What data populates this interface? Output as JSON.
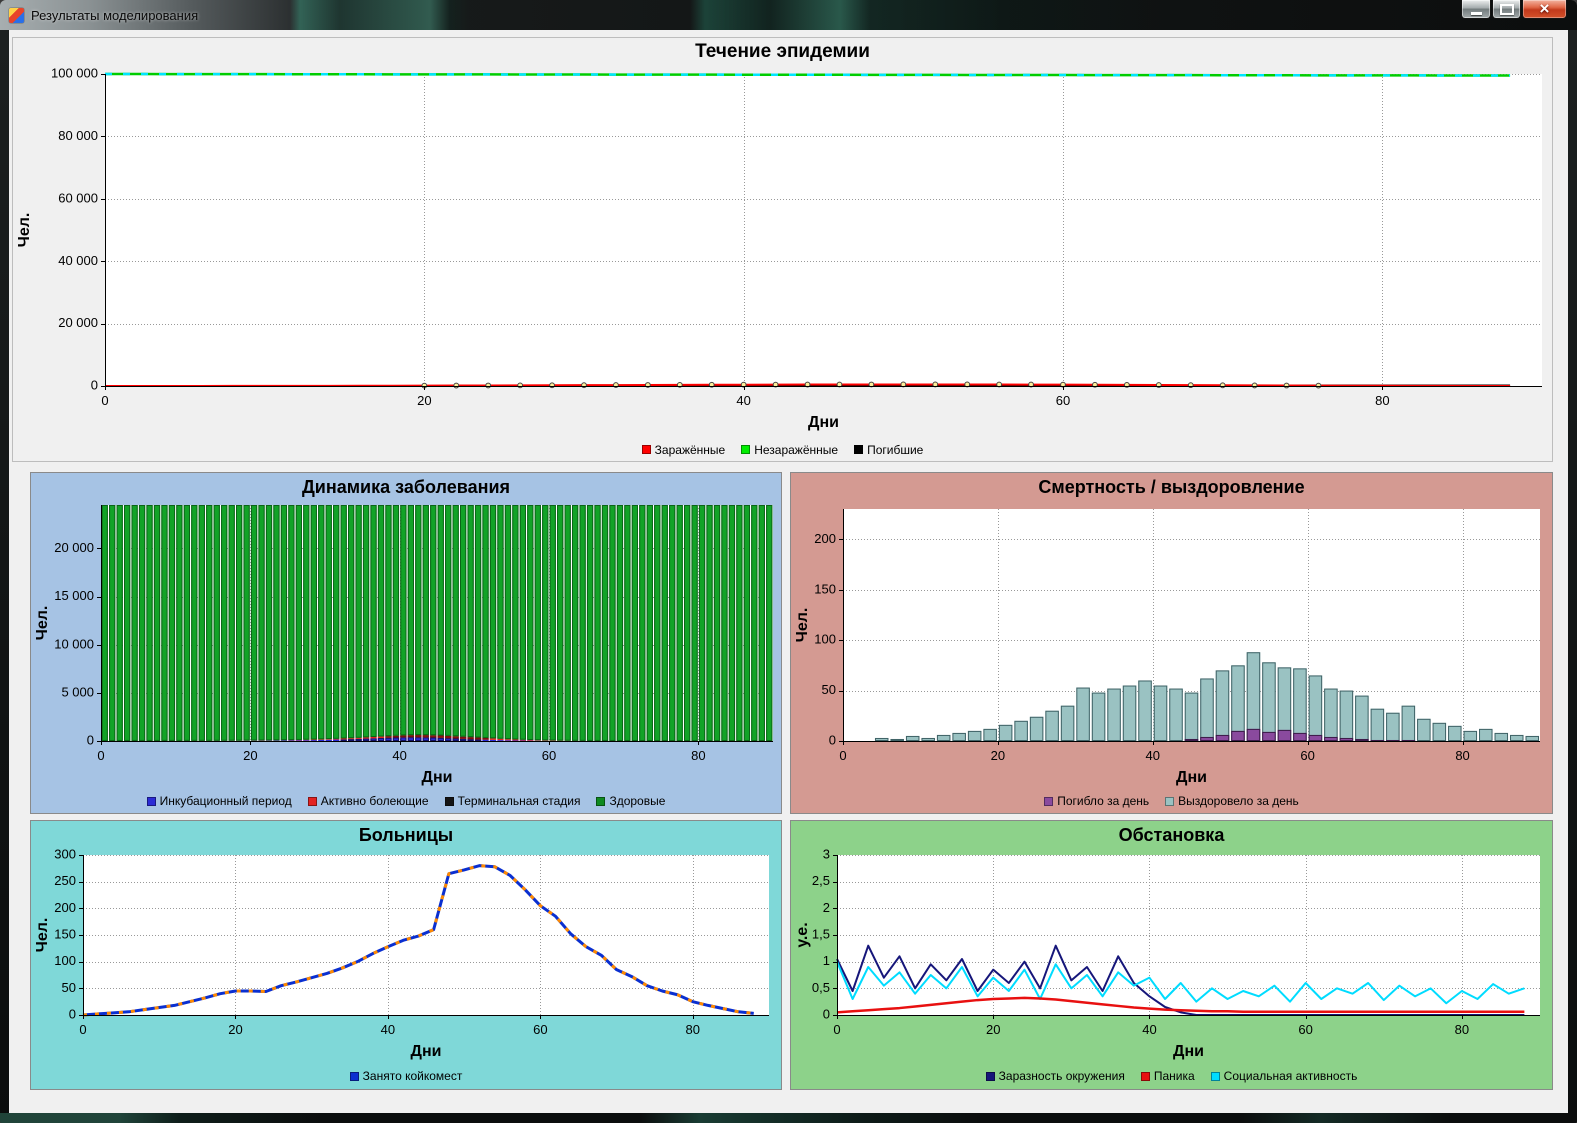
{
  "window": {
    "title": "Результаты моделирования",
    "controls": {
      "close": "×"
    }
  },
  "chart_data": [
    {
      "id": "epidemic",
      "type": "line",
      "title": "Течение эпидемии",
      "xlabel": "Дни",
      "ylabel": "Чел.",
      "bg": "#f0f0f0",
      "xlim": [
        0,
        90
      ],
      "ylim": [
        0,
        100000
      ],
      "xticks": [
        0,
        20,
        40,
        60,
        80
      ],
      "xtick_labels": [
        "0",
        "20",
        "40",
        "60",
        "80"
      ],
      "yticks": [
        0,
        20000,
        40000,
        60000,
        80000,
        100000
      ],
      "ytick_labels": [
        "0",
        "20 000",
        "40 000",
        "60 000",
        "80 000",
        "100 000"
      ],
      "x_start": 0,
      "x_step": 2,
      "series": [
        {
          "name": "Незаражённые",
          "color": "#00cc00",
          "width": 2.5,
          "overlay": {
            "color": "#00e5ff",
            "dash": [
              7,
              11
            ],
            "width": 2.5
          },
          "values": [
            99995,
            99984,
            99973,
            99962,
            99951,
            99940,
            99929,
            99918,
            99907,
            99896,
            99885,
            99874,
            99863,
            99852,
            99841,
            99830,
            99819,
            99808,
            99797,
            99786,
            99775,
            99764,
            99753,
            99742,
            99731,
            99720,
            99709,
            99698,
            99687,
            99676,
            99665,
            99654,
            99643,
            99632,
            99621,
            99610,
            99599,
            99588,
            99577,
            99566,
            99555,
            99544,
            99533,
            99522,
            99511
          ]
        },
        {
          "name": "Погибшие",
          "color": "#000000",
          "width": 1.5,
          "values": [
            0,
            0,
            1,
            2,
            4,
            6,
            9,
            13,
            18,
            24,
            31,
            39,
            48,
            58,
            69,
            81,
            94,
            108,
            122,
            136,
            150,
            163,
            175,
            186,
            196,
            205,
            213,
            220,
            226,
            231,
            235,
            238,
            241,
            243,
            245,
            246,
            247,
            248,
            249,
            250,
            250,
            250,
            250,
            250,
            250
          ]
        },
        {
          "name": "Заражённые",
          "color": "#ff0000",
          "width": 2,
          "marker": {
            "type": "circle",
            "fill": "#ffef9a",
            "stroke": "#444444",
            "r": 2.4,
            "min": 100
          },
          "values": [
            5,
            8,
            12,
            18,
            25,
            34,
            45,
            60,
            78,
            98,
            120,
            145,
            172,
            200,
            230,
            262,
            295,
            328,
            360,
            390,
            418,
            442,
            462,
            478,
            490,
            497,
            500,
            495,
            482,
            460,
            430,
            394,
            354,
            312,
            270,
            228,
            188,
            152,
            120,
            92,
            68,
            48,
            32,
            20,
            12
          ]
        }
      ],
      "legend": [
        {
          "label": "Заражённые",
          "color": "#ff0000"
        },
        {
          "label": "Незаражённые",
          "color": "#00ee00"
        },
        {
          "label": "Погибшие",
          "color": "#000000"
        }
      ]
    },
    {
      "id": "dynamics",
      "type": "stacked-bar",
      "title": "Динамика заболевания",
      "xlabel": "Дни",
      "ylabel": "Чел.",
      "bg": "#a6c3e4",
      "xlim": [
        0,
        90
      ],
      "ylim": [
        0,
        24500
      ],
      "xticks": [
        0,
        20,
        40,
        60,
        80
      ],
      "xtick_labels": [
        "0",
        "20",
        "40",
        "60",
        "80"
      ],
      "yticks": [
        0,
        5000,
        10000,
        15000,
        20000
      ],
      "ytick_labels": [
        "0",
        "5 000",
        "10 000",
        "15 000",
        "20 000"
      ],
      "bar_start": 0,
      "bar_step": 1,
      "series": [
        {
          "name": "Инкубационный период",
          "color": "#2b2bd5",
          "edge": "#111166",
          "values": [
            2,
            2,
            3,
            3,
            4,
            4,
            5,
            5,
            6,
            6,
            8,
            8,
            10,
            10,
            12,
            14,
            16,
            18,
            20,
            24,
            28,
            32,
            38,
            44,
            52,
            60,
            70,
            82,
            95,
            110,
            128,
            148,
            170,
            195,
            220,
            248,
            278,
            308,
            338,
            365,
            388,
            400,
            398,
            385,
            362,
            332,
            298,
            262,
            228,
            195,
            165,
            138,
            114,
            92,
            74,
            58,
            45,
            34,
            26,
            19,
            14,
            10,
            7,
            5,
            4,
            3,
            2,
            2,
            1,
            1,
            1,
            0,
            0,
            0,
            0,
            0,
            0,
            0,
            0,
            0,
            0,
            0,
            0,
            0,
            0,
            0,
            0,
            0,
            0,
            0
          ]
        },
        {
          "name": "Активно болеющие",
          "color": "#e32222",
          "edge": "#7a0f0f",
          "values": [
            1,
            1,
            1,
            2,
            2,
            2,
            3,
            3,
            4,
            4,
            5,
            5,
            6,
            7,
            8,
            9,
            10,
            12,
            14,
            16,
            18,
            21,
            24,
            28,
            32,
            37,
            42,
            48,
            55,
            62,
            70,
            79,
            89,
            100,
            112,
            125,
            138,
            152,
            166,
            180,
            193,
            205,
            215,
            223,
            228,
            230,
            228,
            222,
            213,
            200,
            185,
            168,
            150,
            132,
            114,
            97,
            81,
            66,
            53,
            42,
            33,
            25,
            19,
            14,
            10,
            7,
            5,
            4,
            3,
            2,
            1,
            1,
            1,
            1,
            0,
            0,
            0,
            0,
            0,
            0,
            0,
            0,
            0,
            0,
            0,
            0,
            0,
            0,
            0,
            0
          ]
        },
        {
          "name": "Терминальная стадия",
          "color": "#141414",
          "edge": "#000000",
          "values": [
            0,
            0,
            0,
            0,
            0,
            0,
            0,
            0,
            0,
            0,
            0,
            0,
            0,
            0,
            0,
            0,
            0,
            0,
            0,
            0,
            0,
            0,
            0,
            0,
            0,
            0,
            0,
            0,
            0,
            0,
            0,
            0,
            0,
            0,
            1,
            1,
            1,
            2,
            2,
            3,
            4,
            5,
            6,
            7,
            8,
            9,
            10,
            11,
            12,
            12,
            12,
            11,
            10,
            9,
            8,
            7,
            6,
            5,
            4,
            3,
            2,
            2,
            1,
            1,
            1,
            0,
            0,
            0,
            0,
            0,
            0,
            0,
            0,
            0,
            0,
            0,
            0,
            0,
            0,
            0,
            0,
            0,
            0,
            0,
            0,
            0,
            0,
            0,
            0,
            0
          ]
        },
        {
          "name": "Здоровые",
          "color": "#12a327",
          "edge": "#0b6417",
          "rest": true
        }
      ],
      "legend": [
        {
          "label": "Инкубационный период",
          "color": "#2b2bd5"
        },
        {
          "label": "Активно болеющие",
          "color": "#e32222"
        },
        {
          "label": "Терминальная стадия",
          "color": "#141414"
        },
        {
          "label": "Здоровые",
          "color": "#0e8a20"
        }
      ]
    },
    {
      "id": "mortality",
      "type": "bar",
      "title": "Смертность / выздоровление",
      "xlabel": "Дни",
      "ylabel": "Чел.",
      "bg": "#d49a92",
      "xlim": [
        0,
        90
      ],
      "ylim": [
        0,
        230
      ],
      "xticks": [
        0,
        20,
        40,
        60,
        80
      ],
      "xtick_labels": [
        "0",
        "20",
        "40",
        "60",
        "80"
      ],
      "yticks": [
        0,
        50,
        100,
        150,
        200
      ],
      "ytick_labels": [
        "0",
        "50",
        "100",
        "150",
        "200"
      ],
      "bar_start": 0,
      "bar_step": 2,
      "series": [
        {
          "name": "Выздоровело за день",
          "color": "#9ac2c2",
          "edge": "#3f6266",
          "values": [
            0,
            0,
            3,
            2,
            5,
            3,
            6,
            8,
            10,
            12,
            16,
            20,
            24,
            30,
            35,
            53,
            48,
            52,
            55,
            60,
            55,
            52,
            48,
            62,
            70,
            75,
            88,
            78,
            73,
            72,
            65,
            52,
            50,
            45,
            32,
            28,
            35,
            22,
            18,
            15,
            10,
            12,
            8,
            6,
            5
          ]
        },
        {
          "name": "Погибло за день",
          "color": "#8a4a9e",
          "edge": "#3c1c49",
          "values": [
            0,
            0,
            0,
            0,
            0,
            0,
            0,
            0,
            0,
            0,
            0,
            0,
            0,
            0,
            0,
            0,
            0,
            0,
            0,
            0,
            0,
            0,
            2,
            4,
            6,
            10,
            12,
            9,
            11,
            8,
            6,
            4,
            3,
            2,
            1,
            1,
            1,
            0,
            0,
            0,
            0,
            0,
            0,
            0,
            0
          ]
        }
      ],
      "legend": [
        {
          "label": "Погибло за день",
          "color": "#8a4a9e"
        },
        {
          "label": "Выздоровело за день",
          "color": "#9ac2c2"
        }
      ]
    },
    {
      "id": "hospitals",
      "type": "line",
      "title": "Больницы",
      "xlabel": "Дни",
      "ylabel": "Чел.",
      "bg": "#7fd8d8",
      "xlim": [
        0,
        90
      ],
      "ylim": [
        0,
        300
      ],
      "xticks": [
        0,
        20,
        40,
        60,
        80
      ],
      "xtick_labels": [
        "0",
        "20",
        "40",
        "60",
        "80"
      ],
      "yticks": [
        0,
        50,
        100,
        150,
        200,
        250,
        300
      ],
      "ytick_labels": [
        "0",
        "50",
        "100",
        "150",
        "200",
        "250",
        "300"
      ],
      "x_start": 0,
      "x_step": 2,
      "series": [
        {
          "name": "Занято койкомест",
          "color": "#0a2fd0",
          "width": 3,
          "overlay": {
            "color": "#ff8a00",
            "dash": [
              4,
              8
            ],
            "width": 3
          },
          "values": [
            0,
            2,
            4,
            6,
            10,
            14,
            18,
            25,
            32,
            40,
            45,
            45,
            44,
            55,
            62,
            70,
            78,
            88,
            100,
            115,
            128,
            140,
            148,
            160,
            265,
            272,
            280,
            278,
            262,
            235,
            205,
            185,
            152,
            128,
            112,
            85,
            72,
            55,
            45,
            38,
            25,
            18,
            12,
            6,
            3
          ]
        }
      ],
      "legend": [
        {
          "label": "Занято койкомест",
          "color": "#0a2fd0"
        }
      ]
    },
    {
      "id": "situation",
      "type": "line",
      "title": "Обстановка",
      "xlabel": "Дни",
      "ylabel": "у.е.",
      "bg": "#8dd28a",
      "xlim": [
        0,
        90
      ],
      "ylim": [
        0,
        3
      ],
      "xticks": [
        0,
        20,
        40,
        60,
        80
      ],
      "xtick_labels": [
        "0",
        "20",
        "40",
        "60",
        "80"
      ],
      "yticks": [
        0,
        0.5,
        1,
        1.5,
        2,
        2.5,
        3
      ],
      "ytick_labels": [
        "0",
        "0,5",
        "1",
        "1,5",
        "2",
        "2,5",
        "3"
      ],
      "x_start": 0,
      "x_step": 2,
      "series": [
        {
          "name": "Заразность окружения",
          "color": "#16167a",
          "width": 2,
          "values": [
            1.05,
            0.45,
            1.3,
            0.7,
            1.1,
            0.5,
            0.95,
            0.65,
            1.05,
            0.45,
            0.85,
            0.6,
            1.0,
            0.5,
            1.3,
            0.65,
            0.9,
            0.45,
            1.1,
            0.6,
            0.35,
            0.15,
            0.05,
            0,
            0,
            0,
            0,
            0,
            0,
            0,
            0,
            0,
            0,
            0,
            0,
            0,
            0,
            0,
            0,
            0,
            0,
            0,
            0,
            0,
            0
          ]
        },
        {
          "name": "Социальная активность",
          "color": "#00dcff",
          "width": 2,
          "values": [
            1.0,
            0.3,
            0.9,
            0.55,
            0.8,
            0.4,
            0.75,
            0.5,
            0.9,
            0.35,
            0.7,
            0.45,
            0.85,
            0.3,
            0.95,
            0.5,
            0.75,
            0.35,
            0.8,
            0.55,
            0.7,
            0.3,
            0.6,
            0.25,
            0.5,
            0.3,
            0.45,
            0.35,
            0.55,
            0.25,
            0.6,
            0.3,
            0.5,
            0.4,
            0.6,
            0.28,
            0.55,
            0.35,
            0.5,
            0.22,
            0.45,
            0.3,
            0.58,
            0.4,
            0.5
          ]
        },
        {
          "name": "Паника",
          "color": "#e81010",
          "width": 2.5,
          "values": [
            0.05,
            0.07,
            0.09,
            0.11,
            0.13,
            0.16,
            0.19,
            0.22,
            0.25,
            0.28,
            0.3,
            0.31,
            0.32,
            0.31,
            0.29,
            0.26,
            0.23,
            0.2,
            0.17,
            0.14,
            0.12,
            0.1,
            0.09,
            0.08,
            0.07,
            0.07,
            0.06,
            0.06,
            0.06,
            0.06,
            0.06,
            0.06,
            0.06,
            0.06,
            0.06,
            0.06,
            0.06,
            0.06,
            0.06,
            0.06,
            0.06,
            0.06,
            0.06,
            0.06,
            0.06
          ]
        }
      ],
      "legend": [
        {
          "label": "Заразность окружения",
          "color": "#16167a"
        },
        {
          "label": "Паника",
          "color": "#e81010"
        },
        {
          "label": "Социальная активность",
          "color": "#00dcff"
        }
      ]
    }
  ]
}
